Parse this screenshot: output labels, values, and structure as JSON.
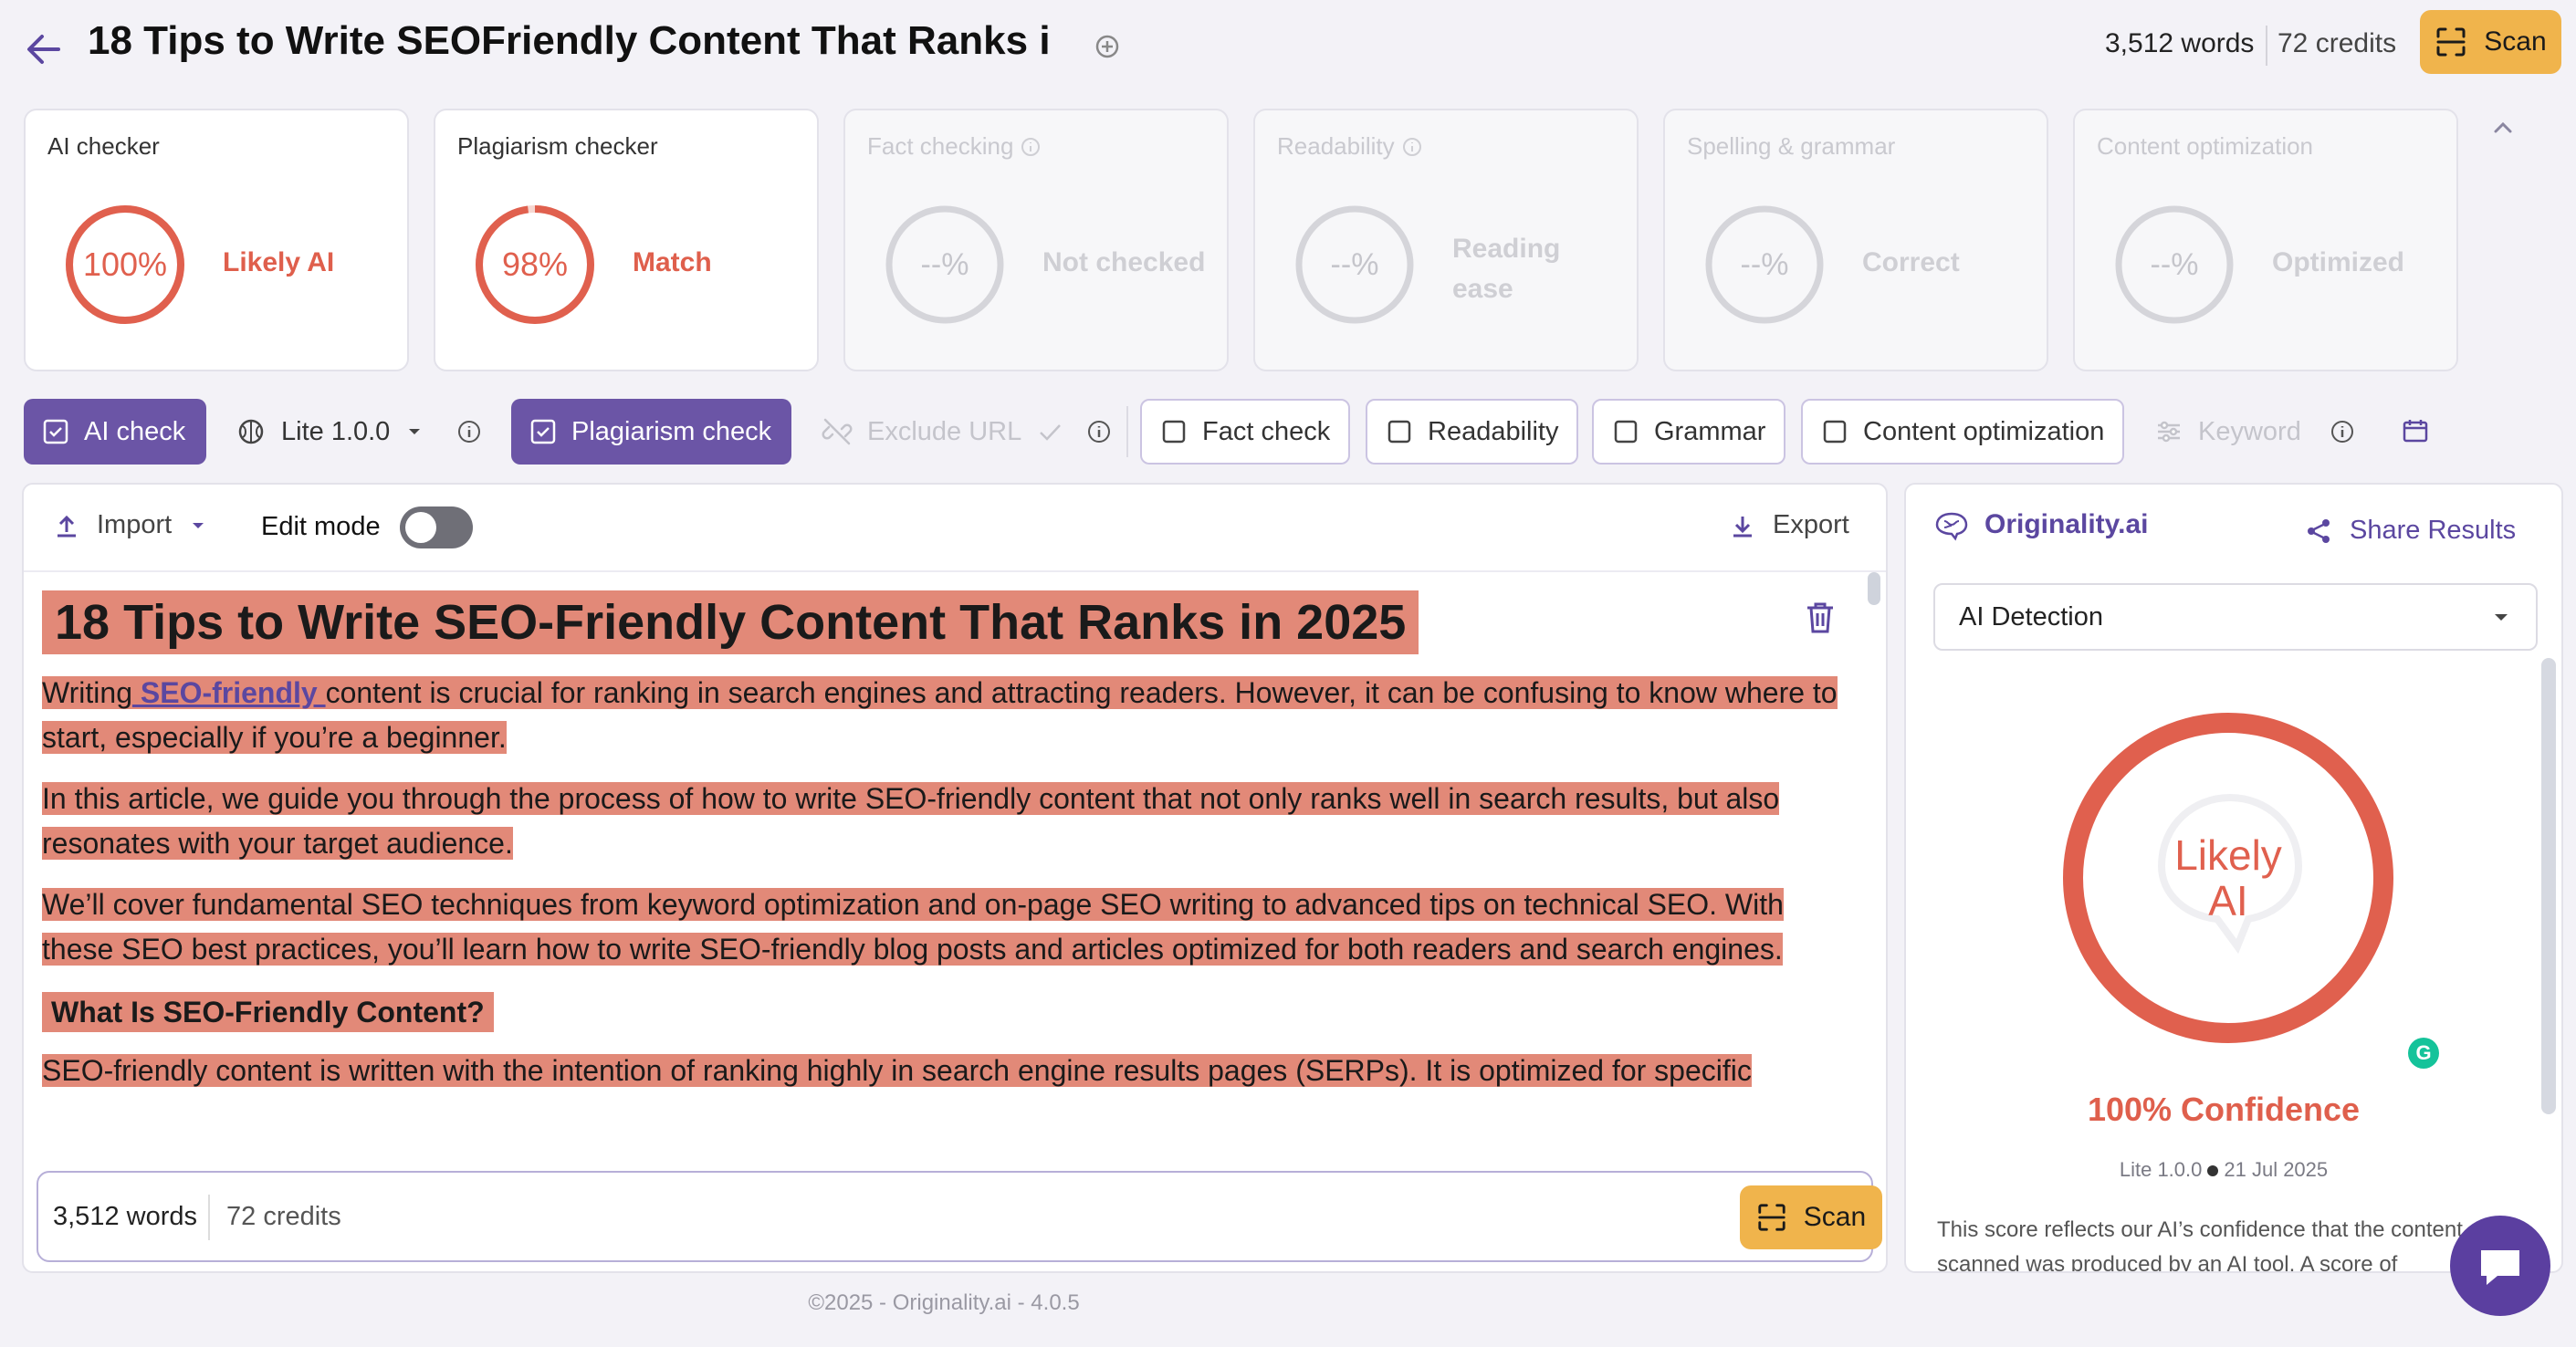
{
  "header": {
    "title": "18 Tips to Write SEOFriendly Content That Ranks i",
    "words": "3,512 words",
    "credits": "72 credits",
    "scan_label": "Scan"
  },
  "cards": [
    {
      "title": "AI checker",
      "value": "100%",
      "status": "Likely AI",
      "fill": 1.0,
      "active": true
    },
    {
      "title": "Plagiarism checker",
      "value": "98%",
      "status": "Match",
      "fill": 0.98,
      "active": true
    },
    {
      "title": "Fact checking",
      "value": "--%",
      "status": "Not checked",
      "active": false
    },
    {
      "title": "Readability",
      "value": "--%",
      "status": "Reading ease",
      "active": false
    },
    {
      "title": "Spelling & grammar",
      "value": "--%",
      "status": "Correct",
      "active": false
    },
    {
      "title": "Content optimization",
      "value": "--%",
      "status": "Optimized",
      "active": false
    }
  ],
  "toolbar": {
    "ai_check": "AI check",
    "model": "Lite 1.0.0",
    "plagiarism_check": "Plagiarism check",
    "exclude_url": "Exclude URL",
    "fact_check": "Fact check",
    "readability": "Readability",
    "grammar": "Grammar",
    "content_optimization": "Content optimization",
    "keyword": "Keyword"
  },
  "editor": {
    "import_label": "Import",
    "edit_mode_label": "Edit mode",
    "edit_mode_on": false,
    "export_label": "Export",
    "heading": "18 Tips to Write SEO-Friendly Content That Ranks in 2025",
    "p1_before": "Writing",
    "p1_link": " SEO-friendly ",
    "p1_after": "content is crucial for ranking in search engines and attracting readers.  However, it can be confusing to know where to start, especially if you’re a beginner.",
    "p2": "In this article, we guide you through the process of how to write SEO-friendly content that not only ranks well in search results, but also resonates with your target audience.",
    "p3": "We’ll cover fundamental SEO techniques from keyword optimization and on-page SEO writing to advanced tips on technical SEO.  With these SEO best practices, you’ll learn how to write SEO-friendly blog posts and articles optimized for both readers and search engines.",
    "h2": "What Is SEO-Friendly Content?",
    "p4": "SEO-friendly content is written with the intention of ranking highly in search engine results pages (SERPs).  It is optimized for specific",
    "words": "3,512 words",
    "credits": "72 credits",
    "scan_label": "Scan"
  },
  "panel": {
    "brand": "Originality.ai",
    "share_label": "Share Results",
    "dropdown_value": "AI Detection",
    "result_label_1": "Likely",
    "result_label_2": "AI",
    "confidence": "100% Confidence",
    "model": "Lite 1.0.0",
    "date": "21 Jul 2025",
    "explanation": "This score reflects our AI’s confidence that the content scanned was produced by an AI tool. A score of"
  },
  "footer": "©2025 - Originality.ai - 4.0.5",
  "colors": {
    "accent": "#6b55a6",
    "ai_red": "#e0604e",
    "highlight": "#e28978",
    "scan_button": "#f0b44c"
  }
}
